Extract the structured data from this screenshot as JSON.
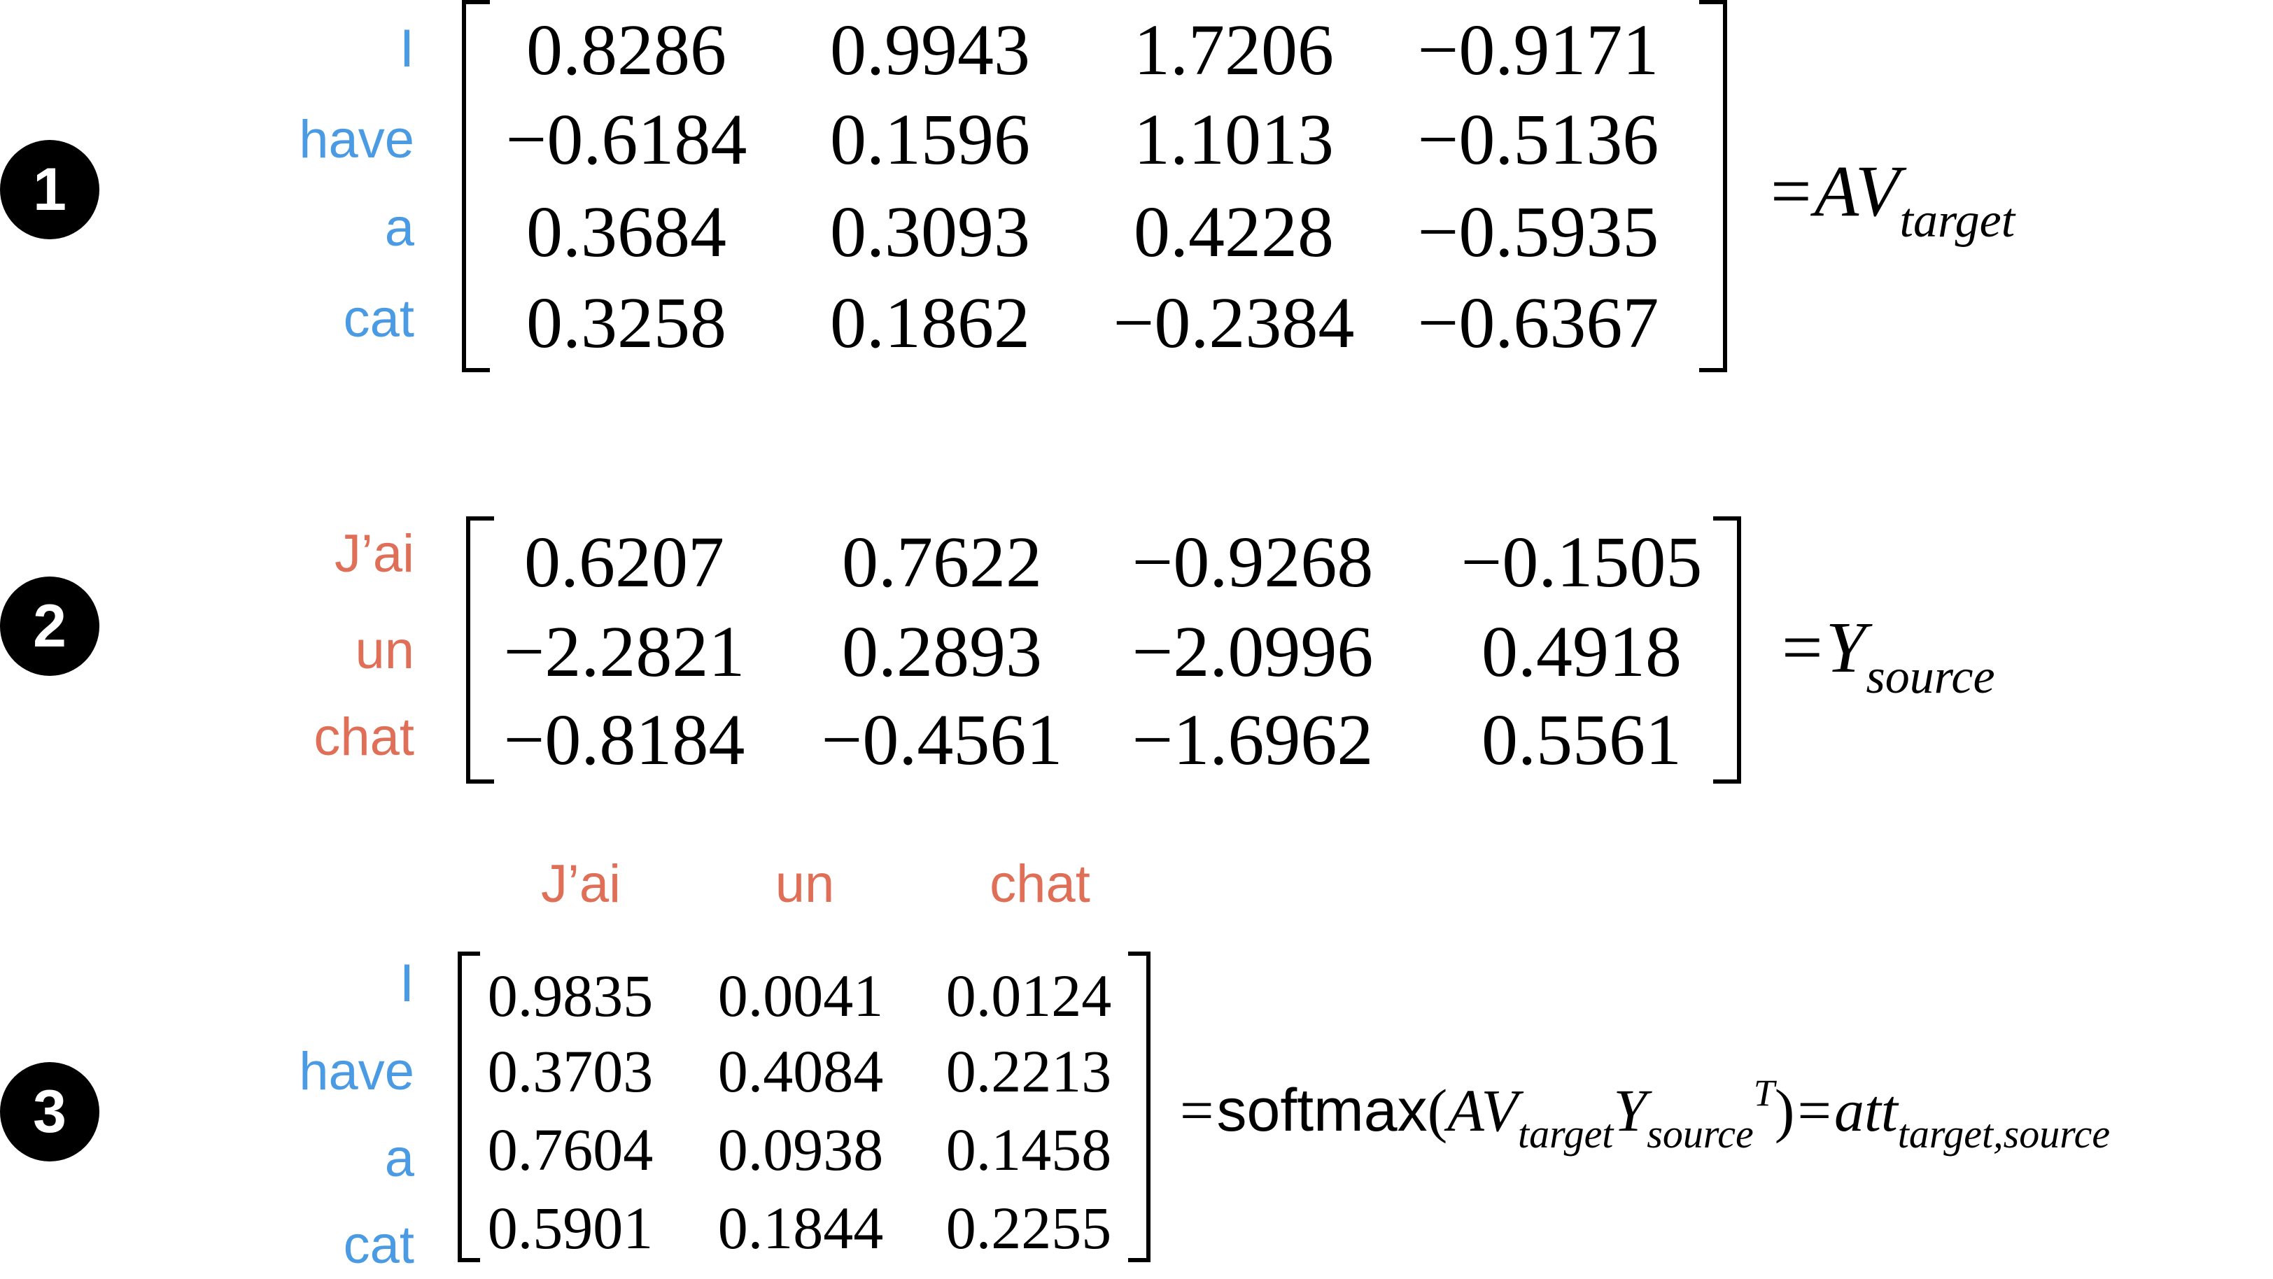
{
  "sections": [
    {
      "number": "1",
      "row_labels": [
        "I",
        "have",
        "a",
        "cat"
      ],
      "matrix": [
        [
          "0.8286",
          "0.9943",
          "1.7206",
          "−0.9171"
        ],
        [
          "−0.6184",
          "0.1596",
          "1.1013",
          "−0.5136"
        ],
        [
          "0.3684",
          "0.3093",
          "0.4228",
          "−0.5935"
        ],
        [
          "0.3258",
          "0.1862",
          "−0.2384",
          "−0.6367"
        ]
      ],
      "equation": {
        "equals": "=",
        "main": "AV",
        "sub": "target"
      }
    },
    {
      "number": "2",
      "row_labels": [
        "J’ai",
        "un",
        "chat"
      ],
      "matrix": [
        [
          "0.6207",
          "0.7622",
          "−0.9268",
          "−0.1505"
        ],
        [
          "−2.2821",
          "0.2893",
          "−2.0996",
          "0.4918"
        ],
        [
          "−0.8184",
          "−0.4561",
          "−1.6962",
          "0.5561"
        ]
      ],
      "equation": {
        "equals": "=",
        "main": "Y",
        "sub": "source"
      }
    },
    {
      "number": "3",
      "column_labels": [
        "J’ai",
        "un",
        "chat"
      ],
      "row_labels": [
        "I",
        "have",
        "a",
        "cat"
      ],
      "matrix": [
        [
          "0.9835",
          "0.0041",
          "0.0124"
        ],
        [
          "0.3703",
          "0.4084",
          "0.2213"
        ],
        [
          "0.7604",
          "0.0938",
          "0.1458"
        ],
        [
          "0.5901",
          "0.1844",
          "0.2255"
        ]
      ],
      "equation": {
        "equals1": "=",
        "func": "softmax",
        "open": "(",
        "av": "AV",
        "av_sub": "target",
        "y": "Y",
        "y_sub": "source",
        "y_sup": "T",
        "close": ")",
        "equals2": "=",
        "att": "att",
        "att_sub": "target,source"
      }
    }
  ],
  "colors": {
    "target_label": "#4a9be3",
    "source_label": "#e06f57",
    "badge": "#000000"
  }
}
